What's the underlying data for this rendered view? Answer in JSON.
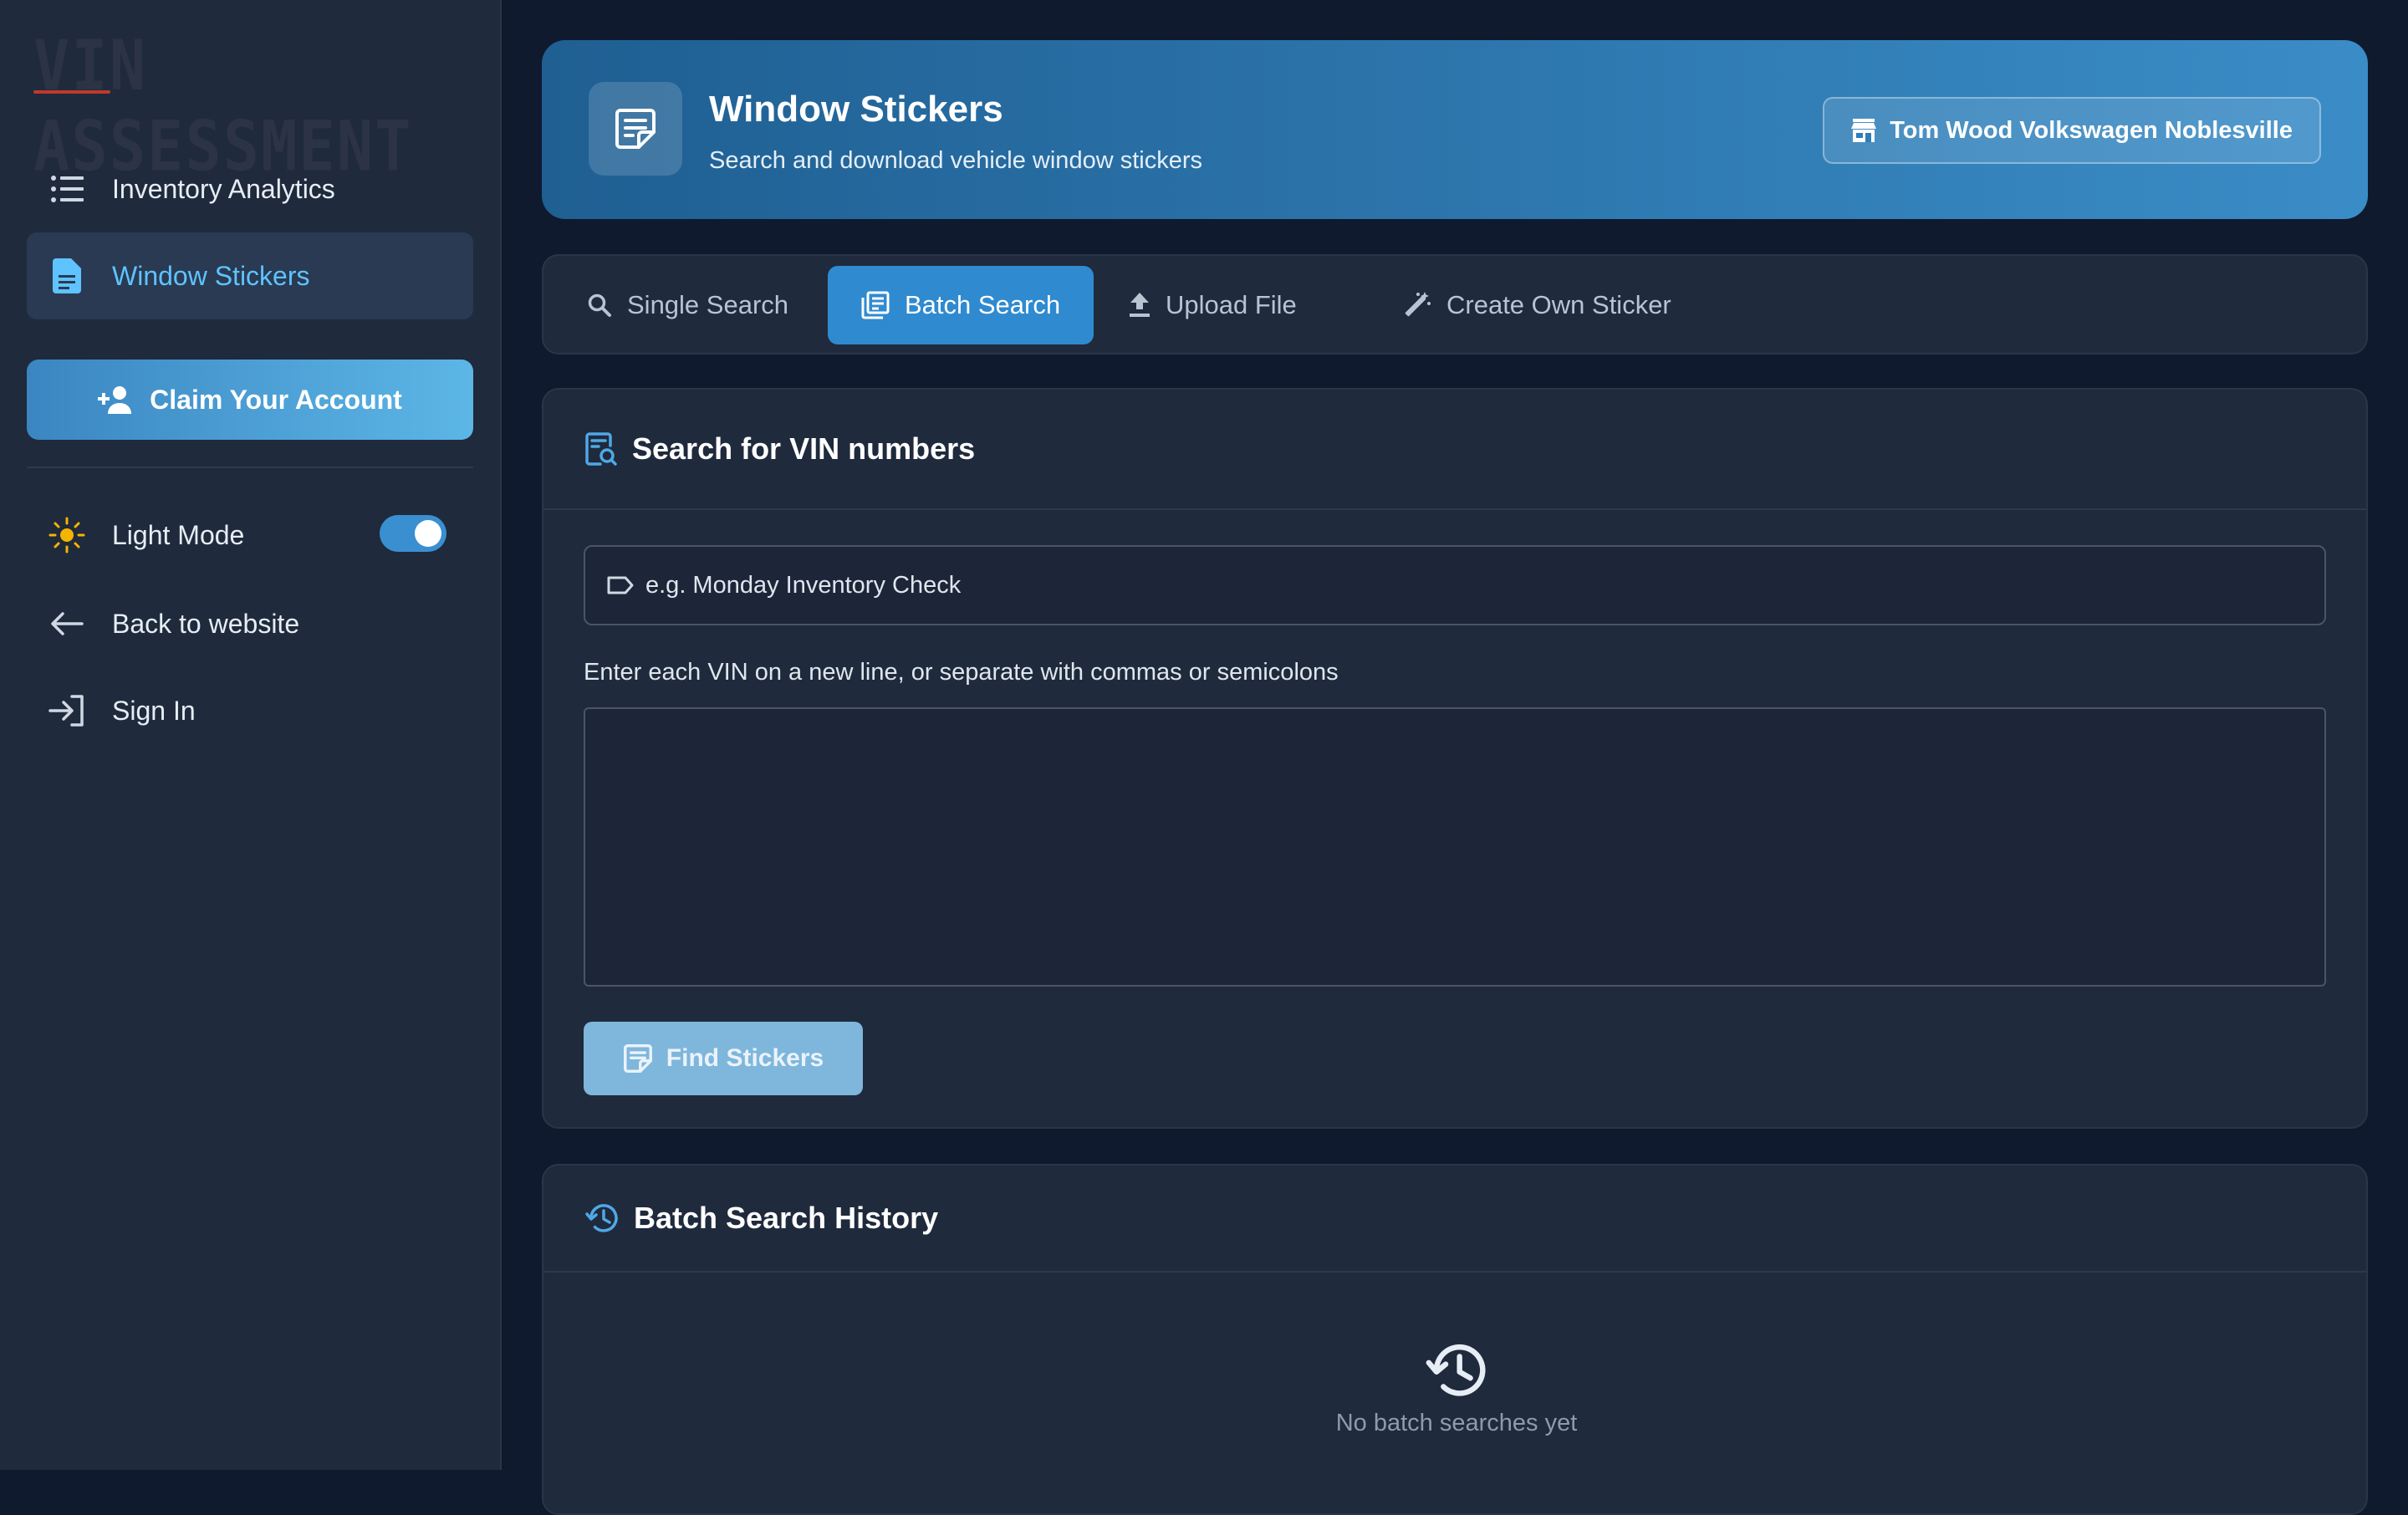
{
  "sidebar": {
    "logo": "VIN ASSESSMENT",
    "nav": [
      {
        "label": "Inventory Analytics",
        "icon": "list-icon",
        "active": false
      },
      {
        "label": "Window Stickers",
        "icon": "document-icon",
        "active": true
      }
    ],
    "claim_label": "Claim Your Account",
    "theme_label": "Light Mode",
    "theme_toggle_on": true,
    "back_label": "Back to website",
    "signin_label": "Sign In"
  },
  "header": {
    "title": "Window Stickers",
    "subtitle": "Search and download vehicle window stickers",
    "dealer": "Tom Wood Volkswagen Noblesville"
  },
  "tabs": [
    {
      "label": "Single Search",
      "icon": "search-icon",
      "active": false
    },
    {
      "label": "Batch Search",
      "icon": "batch-icon",
      "active": true
    },
    {
      "label": "Upload File",
      "icon": "upload-icon",
      "active": false
    },
    {
      "label": "Create Own Sticker",
      "icon": "magic-wand-icon",
      "active": false
    }
  ],
  "search_card": {
    "title": "Search for VIN numbers",
    "name_placeholder": "e.g. Monday Inventory Check",
    "name_value": "",
    "hint": "Enter each VIN on a new line, or separate with commas or semicolons",
    "vin_value": "",
    "find_label": "Find Stickers"
  },
  "history_card": {
    "title": "Batch Search History",
    "empty_text": "No batch searches yet"
  },
  "colors": {
    "accent": "#2f8ad0",
    "link_active": "#5ec3ff",
    "page_bg": "#0f1a2e",
    "card_bg": "#1f2a3c"
  }
}
